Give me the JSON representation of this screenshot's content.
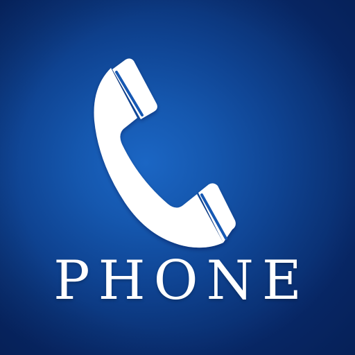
{
  "icon": {
    "label": "PHONE",
    "symbol": "phone-handset-icon",
    "colors": {
      "background_center": "#1b66c4",
      "background_edge": "#08296a",
      "foreground": "#ffffff"
    }
  }
}
